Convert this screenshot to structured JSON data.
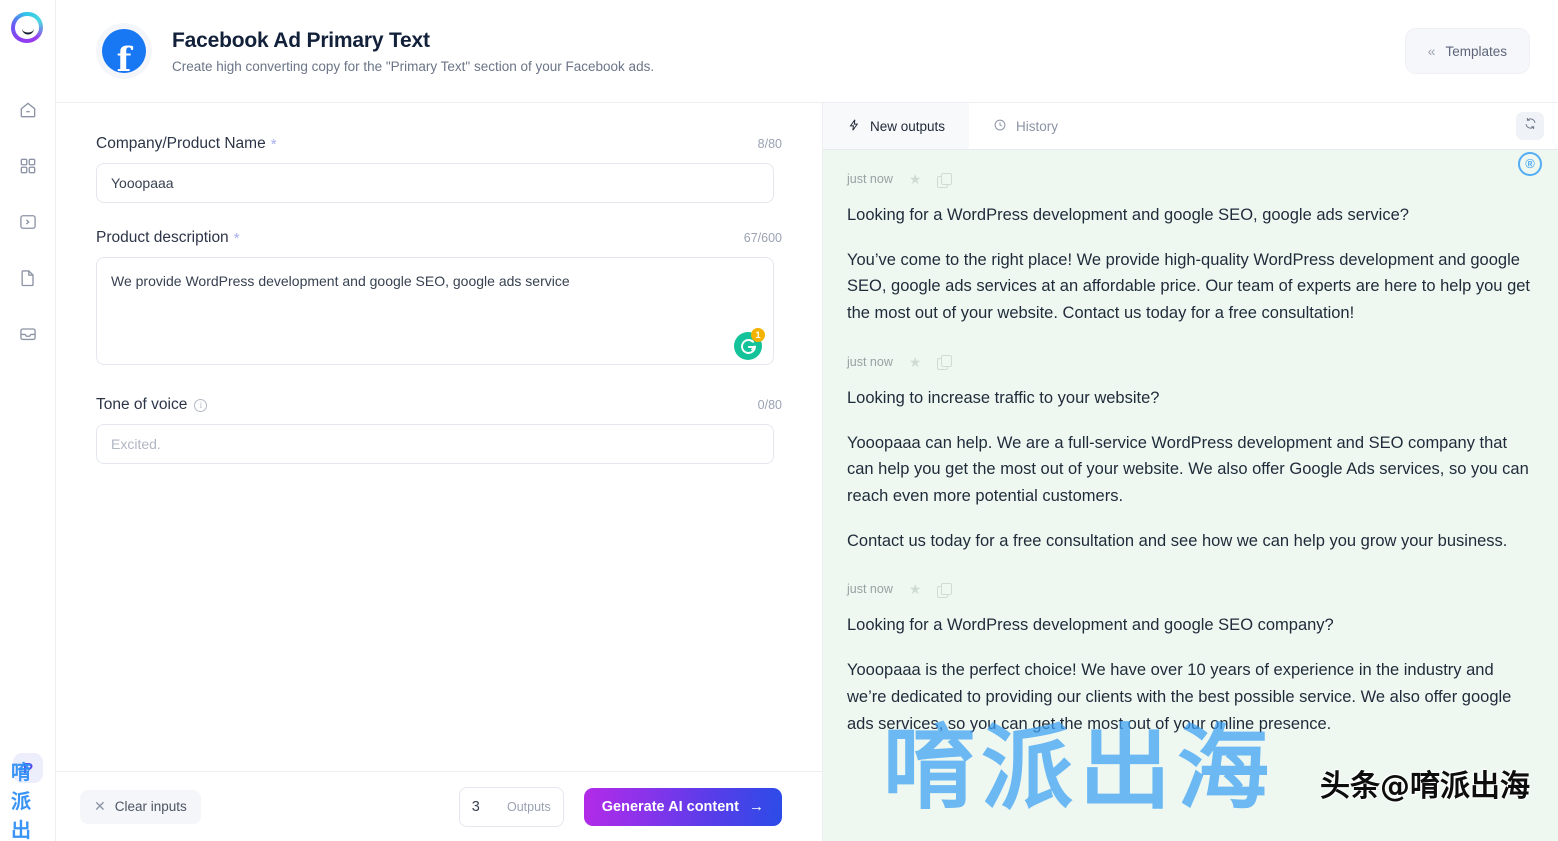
{
  "rail": {
    "logo_name": "brand-logo",
    "items": [
      {
        "name": "home",
        "icon": "home-icon"
      },
      {
        "name": "templates-grid",
        "icon": "grid-icon"
      },
      {
        "name": "playground",
        "icon": "terminal-icon"
      },
      {
        "name": "documents",
        "icon": "document-icon"
      },
      {
        "name": "inbox",
        "icon": "inbox-icon"
      }
    ],
    "avatar_label": "P"
  },
  "header": {
    "title": "Facebook Ad Primary Text",
    "subtitle": "Create high converting copy for the \"Primary Text\" section of your Facebook ads.",
    "templates_label": "Templates",
    "templates_chevron": "«",
    "icon": "facebook-icon",
    "facebook_blue": "#1877f2"
  },
  "form": {
    "fields": [
      {
        "label": "Company/Product Name",
        "required": "*",
        "counter": "8/80",
        "value": "Yooopaaa",
        "placeholder": ""
      },
      {
        "label": "Product description",
        "required": "*",
        "counter": "67/600",
        "value": "We provide WordPress development and google SEO, google ads service",
        "placeholder": ""
      },
      {
        "label": "Tone of voice",
        "required": "",
        "counter": "0/80",
        "value": "",
        "placeholder": "Excited."
      }
    ],
    "grammarly_badge": "1",
    "grammarly_color": "#15c39a",
    "grammarly_badge_color": "#f5b301"
  },
  "footer": {
    "clear_label": "Clear inputs",
    "clear_icon": "close-icon",
    "outputs_value": "3",
    "outputs_label": "Outputs",
    "generate_label": "Generate AI content",
    "generate_arrow": "→",
    "gradient_from": "#b32ae8",
    "gradient_to": "#2b4ce8"
  },
  "outputs": {
    "tabs": [
      {
        "label": "New outputs",
        "icon": "lightning-icon",
        "active": true
      },
      {
        "label": "History",
        "icon": "clock-icon",
        "active": false
      }
    ],
    "refresh_icon": "refresh-icon",
    "panel_bg": "#eef8f0",
    "cards": [
      {
        "time": "just now",
        "star_icon": "star-icon",
        "copy_icon": "copy-icon",
        "paragraphs": [
          "Looking for a WordPress development and google SEO, google ads service?",
          "You’ve come to the right place! We provide high-quality WordPress development and google SEO, google ads services at an affordable price. Our team of experts are here to help you get the most out of your website. Contact us today for a free consultation!"
        ]
      },
      {
        "time": "just now",
        "star_icon": "star-icon",
        "copy_icon": "copy-icon",
        "paragraphs": [
          "Looking to increase traffic to your website?",
          "Yooopaaa can help. We are a full-service WordPress development and SEO company that can help you get the most out of your website. We also offer Google Ads services, so you can reach even more potential customers.",
          "Contact us today for a free consultation and see how we can help you grow your business."
        ]
      },
      {
        "time": "just now",
        "star_icon": "star-icon",
        "copy_icon": "copy-icon",
        "paragraphs": [
          "Looking for a WordPress development and google SEO company?",
          "Yooopaaa is the perfect choice! We have over 10 years of experience in the industry and we’re dedicated to providing our clients with the best possible service. We also offer google ads services, so you can get the most out of your online presence."
        ]
      }
    ]
  },
  "watermark": {
    "cn_text": "唷派出海",
    "handle": "头条@唷派出海",
    "registered": "®",
    "color": "#3aa0f5"
  }
}
